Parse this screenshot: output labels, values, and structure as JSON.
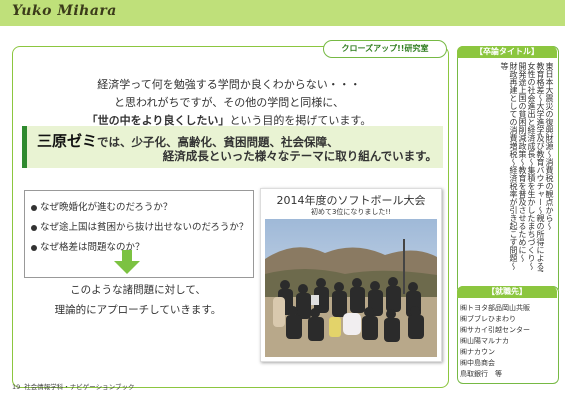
{
  "header": {
    "name": "Yuko  Mihara"
  },
  "badge": {
    "label": "クローズアップ!!研究室"
  },
  "intro": {
    "line1": "経済学って何を勉強する学問か良くわからない・・・",
    "line2": "と思われがちですが、その他の学問と同様に、",
    "line3_emph": "「世の中をより良くしたい」",
    "line3_rest": "という目的を掲げています。"
  },
  "highlight": {
    "name": "三原ゼミ",
    "line1_rest": "では、少子化、高齢化、貧困問題、社会保障、",
    "line2": "経済成長といった様々なテーマに取り組んでいます。"
  },
  "questions": [
    "なぜ晩婚化が進むのだろうか？",
    "なぜ途上国は貧困から抜け出せないのだろうか？",
    "なぜ格差は問題なのか？"
  ],
  "conclusion": {
    "line1": "このような諸問題に対して、",
    "line2": "理論的にアプローチしていきます。"
  },
  "photo": {
    "title": "2014年度のソフトボール大会",
    "subtitle": "初めて3位になりました!!"
  },
  "theses_section": {
    "heading": "【卒論タイトル】",
    "items": [
      "東日本大震災の復興財源〜消費税の観点から〜",
      "教育格差〜大学進学及び教育バウチャー〜親の所得による子どもの格差〜",
      "女性の社会進出と経済成長〜集積を生かしたまちづくり〜",
      "開発途上国の貧困削減政策〜教育を普及させるために〜",
      "財政再建としての消費増税〜経済税率が引き起こす問題〜",
      "等"
    ]
  },
  "employers_section": {
    "heading": "【就職先】",
    "items": [
      "㈱トヨタ部品岡山共販",
      "㈱ブブレひまわり",
      "㈱サカイ引越センター",
      "㈱山陽マルナカ",
      "㈱ナカウン",
      "㈱中島商会",
      "鳥取銀行　等"
    ]
  },
  "footer": {
    "page": "19",
    "text": "社会情報学科・ナビゲーションブック"
  },
  "colors": {
    "header_green": "#bfe07a",
    "accent_green": "#8cc63f",
    "dark_green": "#2f8a2f",
    "highlight_bg": "#e9f3d3"
  }
}
